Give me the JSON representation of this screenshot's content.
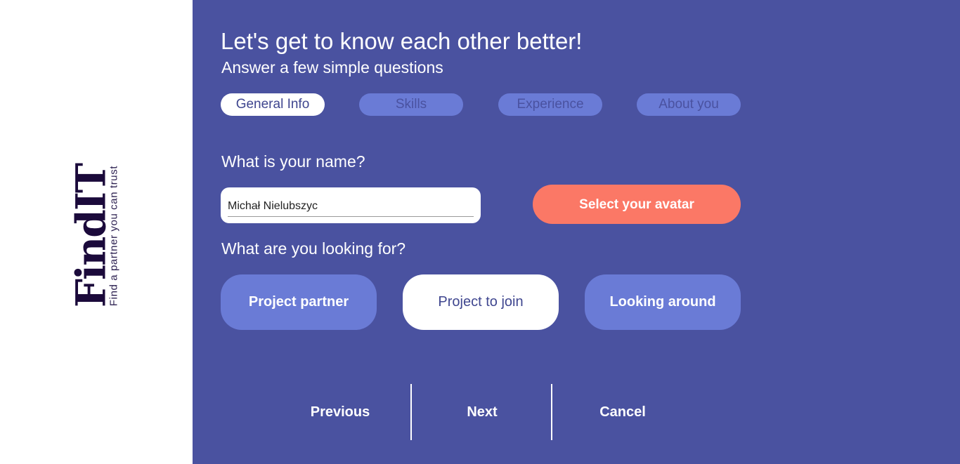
{
  "brand": {
    "title": "FindIT",
    "tagline": "Find a partner you can trust"
  },
  "header": {
    "title": "Let's get to know each other better!",
    "subtitle": "Answer a few simple questions"
  },
  "tabs": [
    {
      "label": "General Info",
      "active": true
    },
    {
      "label": "Skills",
      "active": false
    },
    {
      "label": "Experience",
      "active": false
    },
    {
      "label": "About you",
      "active": false
    }
  ],
  "name_section": {
    "question": "What is your name?",
    "value": "Michał Nielubszyc",
    "avatar_button": "Select your avatar"
  },
  "looking_section": {
    "question": "What are you looking for?",
    "options": [
      {
        "label": "Project partner",
        "selected": false
      },
      {
        "label": "Project to join",
        "selected": true
      },
      {
        "label": "Looking around",
        "selected": false
      }
    ]
  },
  "footer_nav": {
    "previous": "Previous",
    "next": "Next",
    "cancel": "Cancel"
  },
  "colors": {
    "main_bg": "#4a52a0",
    "tab_inactive": "#6a7bd6",
    "accent": "#fb7866",
    "logo": "#1b0a3b"
  }
}
